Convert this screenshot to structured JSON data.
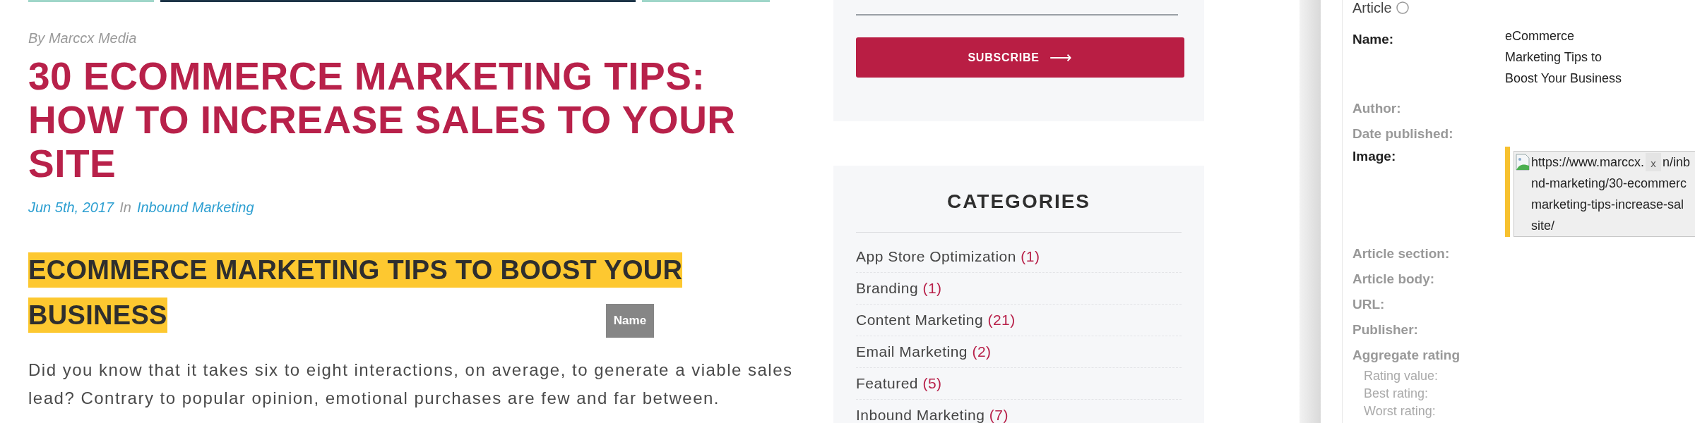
{
  "article": {
    "byline": "By Marccx Media",
    "title": "30 ECOMMERCE MARKETING TIPS: HOW TO INCREASE SALES TO YOUR SITE",
    "date": "Jun 5th, 2017",
    "in_label": "In",
    "category": "Inbound Marketing",
    "heading": "ECOMMERCE MARKETING TIPS TO BOOST YOUR BUSINESS",
    "tooltip": "Name",
    "paragraph": "Did you know that it takes six to eight interactions, on average, to generate a viable sales lead? Contrary to popular opinion, emotional purchases are few and far between."
  },
  "sidebar": {
    "subscribe_button": "SUBSCRIBE",
    "button_arrow": "⟶",
    "categories_title": "CATEGORIES",
    "categories": [
      {
        "name": "App Store Optimization",
        "count": "(1)"
      },
      {
        "name": "Branding",
        "count": "(1)"
      },
      {
        "name": "Content Marketing",
        "count": "(21)"
      },
      {
        "name": "Email Marketing",
        "count": "(2)"
      },
      {
        "name": "Featured",
        "count": "(5)"
      },
      {
        "name": "Inbound Marketing",
        "count": "(7)"
      }
    ]
  },
  "structured_data": {
    "type_label": "Article",
    "fields": [
      {
        "label": "Name:",
        "kind": "text",
        "filled": true,
        "value_lines": [
          "eCommerce",
          "Marketing Tips to",
          "Boost Your Business"
        ]
      },
      {
        "label": "Author:",
        "kind": "text",
        "filled": false
      },
      {
        "label": "Date published:",
        "kind": "text",
        "filled": false
      },
      {
        "label": "Image:",
        "kind": "image",
        "filled": true,
        "value_start": "https://www.marccx.",
        "close": "x",
        "value_after": "n/inb",
        "value_lines": [
          "nd-marketing/30-ecommerc",
          "marketing-tips-increase-sal",
          "site/"
        ]
      },
      {
        "label": "Article section:",
        "kind": "text",
        "filled": false
      },
      {
        "label": "Article body:",
        "kind": "text",
        "filled": false
      },
      {
        "label": "URL:",
        "kind": "text",
        "filled": false
      },
      {
        "label": "Publisher:",
        "kind": "text",
        "filled": false
      },
      {
        "label": "Aggregate rating",
        "kind": "group",
        "filled": false,
        "children": [
          {
            "label": "Rating value:"
          },
          {
            "label": "Best rating:"
          },
          {
            "label": "Worst rating:"
          }
        ]
      }
    ]
  }
}
